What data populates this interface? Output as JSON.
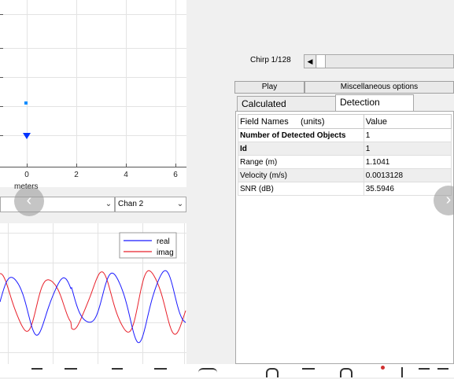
{
  "range_plot": {
    "x_tick_labels": [
      "0",
      "2",
      "4",
      "6"
    ],
    "x_axis_label": "meters",
    "accent_color": "#0033ff"
  },
  "channel_select": {
    "left_value": "",
    "right_value": "Chan 2"
  },
  "time_plot": {
    "legend": [
      "real",
      "imag"
    ],
    "colors": {
      "real": "#1a1aff",
      "imag": "#e8202a"
    }
  },
  "chirp": {
    "label": "Chirp 1/128",
    "current": 1,
    "total": 128
  },
  "buttons": {
    "play": "Play",
    "misc": "Miscellaneous options"
  },
  "tabs": [
    {
      "label": "Calculated Parameters",
      "active": false
    },
    {
      "label": "Detection Results",
      "active": true
    }
  ],
  "results_table": {
    "headers": [
      "Field Names     (units)",
      "Value"
    ],
    "rows": [
      {
        "field": "Number of Detected Objects",
        "value": "1",
        "bold": true
      },
      {
        "field": "Id",
        "value": "1",
        "bold": true
      },
      {
        "field": "Range (m)",
        "value": "1.1041",
        "bold": false
      },
      {
        "field": "Velocity (m/s)",
        "value": "0.0013128",
        "bold": false
      },
      {
        "field": "SNR (dB)",
        "value": "35.5946",
        "bold": false
      }
    ]
  },
  "nav": {
    "prev_icon": "chevron-left-icon",
    "next_icon": "chevron-right-icon"
  }
}
